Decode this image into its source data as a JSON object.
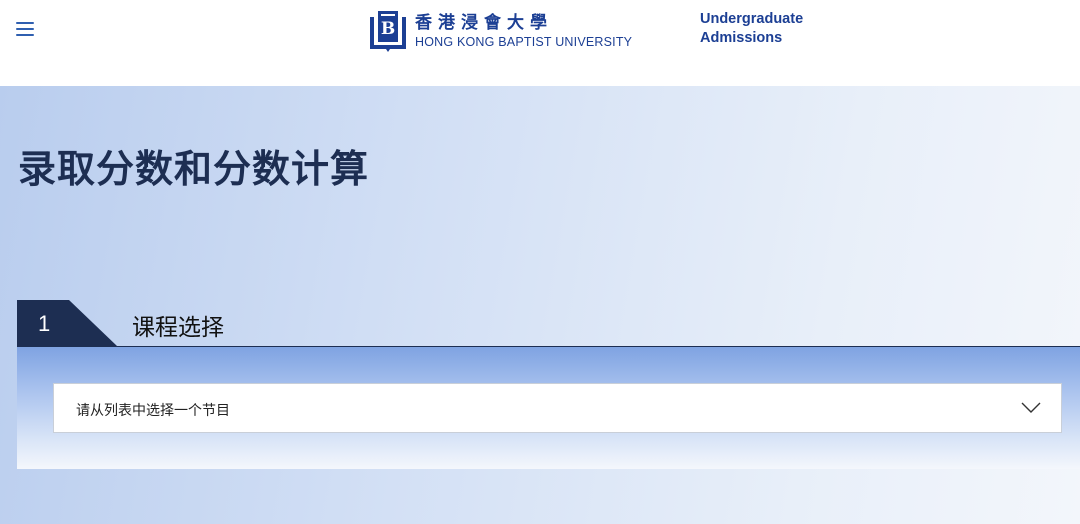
{
  "header": {
    "logo": {
      "name_zh": "香港浸會大學",
      "name_en": "HONG KONG BAPTIST UNIVERSITY"
    },
    "section_link": {
      "line1": "Undergraduate",
      "line2": "Admissions"
    }
  },
  "main": {
    "title": "录取分数和分数计算",
    "step": {
      "number": "1",
      "title": "课程选择",
      "select_value": "请从列表中选择一个节目"
    }
  },
  "colors": {
    "brand_blue": "#1c3f94",
    "navy": "#1d2e52"
  },
  "icons": [
    "menu-icon",
    "hkbu-logo-icon",
    "chevron-down-icon"
  ]
}
